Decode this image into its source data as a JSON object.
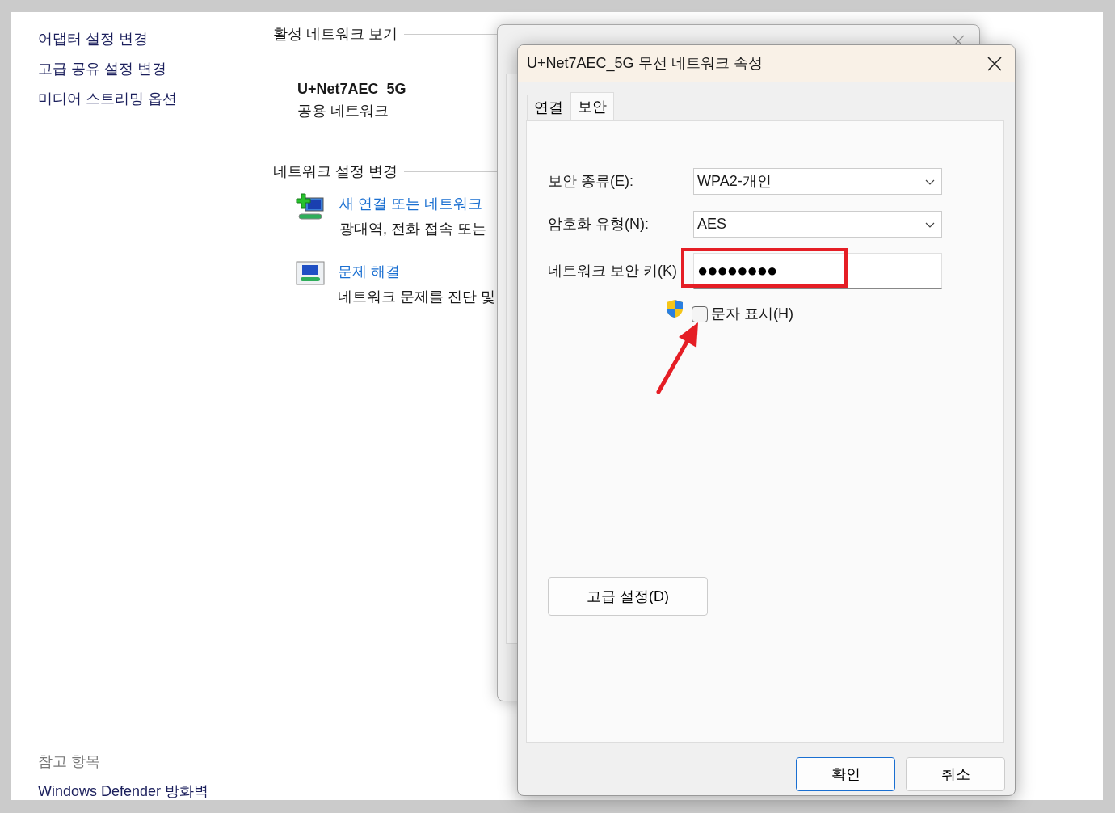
{
  "main_window": {
    "sidebar_links": [
      {
        "label": "어댑터 설정 변경"
      },
      {
        "label": "고급 공유 설정 변경"
      },
      {
        "label": "미디어 스트리밍 옵션"
      }
    ],
    "see_also": {
      "heading": "참고 항목",
      "links": [
        "Windows Defender 방화벽"
      ]
    },
    "active_networks": {
      "heading": "활성 네트워크 보기",
      "name": "U+Net7AEC_5G",
      "type": "공용 네트워크"
    },
    "change_settings": {
      "heading": "네트워크 설정 변경",
      "tasks": [
        {
          "kind": "new-connection",
          "link": "새 연결 또는 네트워크",
          "description": "광대역, 전화 접속 또는"
        },
        {
          "kind": "troubleshoot",
          "link": "문제 해결",
          "description": "네트워크 문제를 진단 및"
        }
      ]
    }
  },
  "dialog": {
    "title": "U+Net7AEC_5G 무선 네트워크 속성",
    "tabs": [
      {
        "label": "연결",
        "selected": false
      },
      {
        "label": "보안",
        "selected": true
      }
    ],
    "fields": [
      {
        "kind": "select",
        "label": "보안 종류(E):",
        "value": "WPA2-개인"
      },
      {
        "kind": "select",
        "label": "암호화 유형(N):",
        "value": "AES"
      },
      {
        "kind": "password",
        "label": "네트워크 보안 키(K)",
        "value": "●●●●●●●●",
        "highlighted": true
      }
    ],
    "show_characters": {
      "label": "문자 표시(H)",
      "checked": false
    },
    "advanced_button": "고급 설정(D)",
    "buttons": [
      {
        "label": "확인",
        "default": true
      },
      {
        "label": "취소",
        "default": false
      }
    ]
  }
}
